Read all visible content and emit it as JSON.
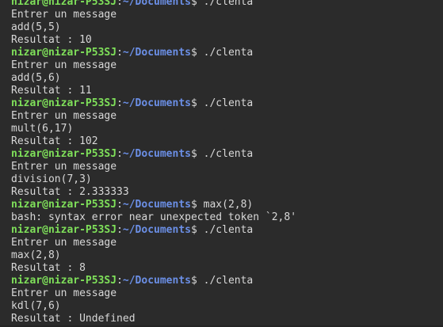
{
  "prompt": {
    "user_host": "nizar@nizar-P53SJ",
    "colon": ":",
    "path": "~/Documents",
    "dollar": "$ "
  },
  "lines": [
    {
      "kind": "prompt",
      "command": "./clenta"
    },
    {
      "kind": "out",
      "text": "Entrer un message"
    },
    {
      "kind": "out",
      "text": "add(5,5)"
    },
    {
      "kind": "out",
      "text": "Resultat : 10"
    },
    {
      "kind": "prompt",
      "command": "./clenta"
    },
    {
      "kind": "out",
      "text": "Entrer un message"
    },
    {
      "kind": "out",
      "text": "add(5,6)"
    },
    {
      "kind": "out",
      "text": "Resultat : 11"
    },
    {
      "kind": "prompt",
      "command": "./clenta"
    },
    {
      "kind": "out",
      "text": "Entrer un message"
    },
    {
      "kind": "out",
      "text": "mult(6,17)"
    },
    {
      "kind": "out",
      "text": "Resultat : 102"
    },
    {
      "kind": "prompt",
      "command": "./clenta"
    },
    {
      "kind": "out",
      "text": "Entrer un message"
    },
    {
      "kind": "out",
      "text": "division(7,3)"
    },
    {
      "kind": "out",
      "text": "Resultat : 2.333333"
    },
    {
      "kind": "prompt",
      "command": "max(2,8)"
    },
    {
      "kind": "out",
      "text": "bash: syntax error near unexpected token `2,8'"
    },
    {
      "kind": "prompt",
      "command": "./clenta"
    },
    {
      "kind": "out",
      "text": "Entrer un message"
    },
    {
      "kind": "out",
      "text": "max(2,8)"
    },
    {
      "kind": "out",
      "text": "Resultat : 8"
    },
    {
      "kind": "prompt",
      "command": "./clenta"
    },
    {
      "kind": "out",
      "text": "Entrer un message"
    },
    {
      "kind": "out",
      "text": "kdl(7,6)"
    },
    {
      "kind": "out",
      "text": "Resultat : Undefined"
    }
  ]
}
